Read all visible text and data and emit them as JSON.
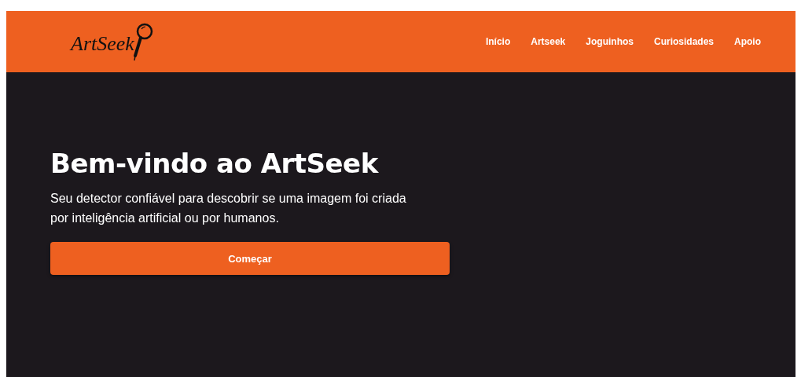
{
  "header": {
    "logo": "ArtSeek",
    "nav": [
      {
        "label": "Início"
      },
      {
        "label": "Artseek"
      },
      {
        "label": "Joguinhos"
      },
      {
        "label": "Curiosidades"
      },
      {
        "label": "Apoio"
      }
    ]
  },
  "hero": {
    "title": "Bem-vindo ao ArtSeek",
    "subtitle": "Seu detector confiável para descobrir se uma imagem foi criada por inteligência artificial ou por humanos.",
    "button": "Começar"
  }
}
